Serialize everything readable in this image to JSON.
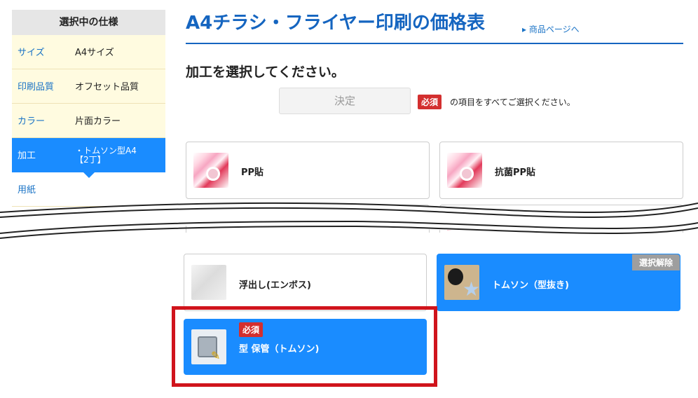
{
  "sidebar": {
    "heading": "選択中の仕様",
    "rows": [
      {
        "key": "サイズ",
        "value": "A4サイズ"
      },
      {
        "key": "印刷品質",
        "value": "オフセット品質"
      },
      {
        "key": "カラー",
        "value": "片面カラー"
      },
      {
        "key": "加工",
        "value": "・トムソン型A4\n【2丁】"
      },
      {
        "key": "用紙",
        "value": ""
      }
    ]
  },
  "page": {
    "title": "A4チラシ・フライヤー印刷の価格表",
    "title_link": "▸ 商品ページへ",
    "subheading": "加工を選択してください。",
    "decide_label": "決定",
    "required_badge": "必須",
    "required_note": "の項目をすべてご選択ください。"
  },
  "options": {
    "pp": "PP貼",
    "antibac": "抗菌PP貼",
    "emboss": "浮出し(エンボス)",
    "thomson": "トムソン（型抜き)",
    "deselect": "選択解除",
    "mold_badge": "必須",
    "mold_storage": "型 保管（トムソン)"
  },
  "colors": {
    "accent": "#1a8cff",
    "title": "#1565c0",
    "required": "#d32f2f",
    "highlight": "#d0141c"
  }
}
